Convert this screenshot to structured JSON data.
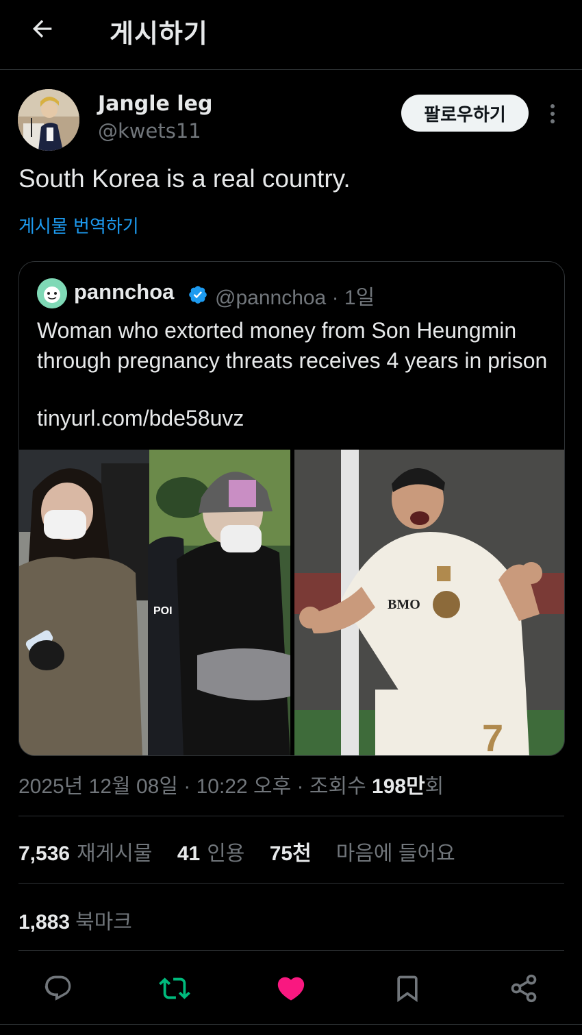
{
  "header": {
    "title": "게시하기"
  },
  "author": {
    "name": "Jangle leg",
    "handle": "@kwets11",
    "follow_label": "팔로우하기"
  },
  "tweet": {
    "text": "South Korea is a real country.",
    "translate_label": "게시물 번역하기"
  },
  "quote": {
    "name": "pannchoa",
    "handle_time": "@pannchoa · 1일",
    "text": "Woman who extorted money from Son Heungmin through pregnancy threats receives 4 years in prison",
    "link": "tinyurl.com/bde58uvz"
  },
  "meta": {
    "date": "2025년 12월 08일 · 10:22 오후 · 조회수 ",
    "views_num": "198만",
    "views_unit": "회"
  },
  "stats": {
    "retweets_num": "7,536",
    "retweets_label": "재게시물",
    "quotes_num": "41",
    "quotes_label": "인용",
    "likes_num": "75천",
    "likes_label": "마음에 들어요",
    "bookmarks_num": "1,883",
    "bookmarks_label": "북마크"
  },
  "colors": {
    "accent": "#1d9bf0",
    "like": "#f91880",
    "retweet": "#00ba7c",
    "muted": "#71767b"
  },
  "icons": [
    "back-arrow-icon",
    "more-vertical-icon",
    "verified-icon",
    "reply-icon",
    "retweet-icon",
    "like-icon",
    "bookmark-icon",
    "share-icon"
  ]
}
